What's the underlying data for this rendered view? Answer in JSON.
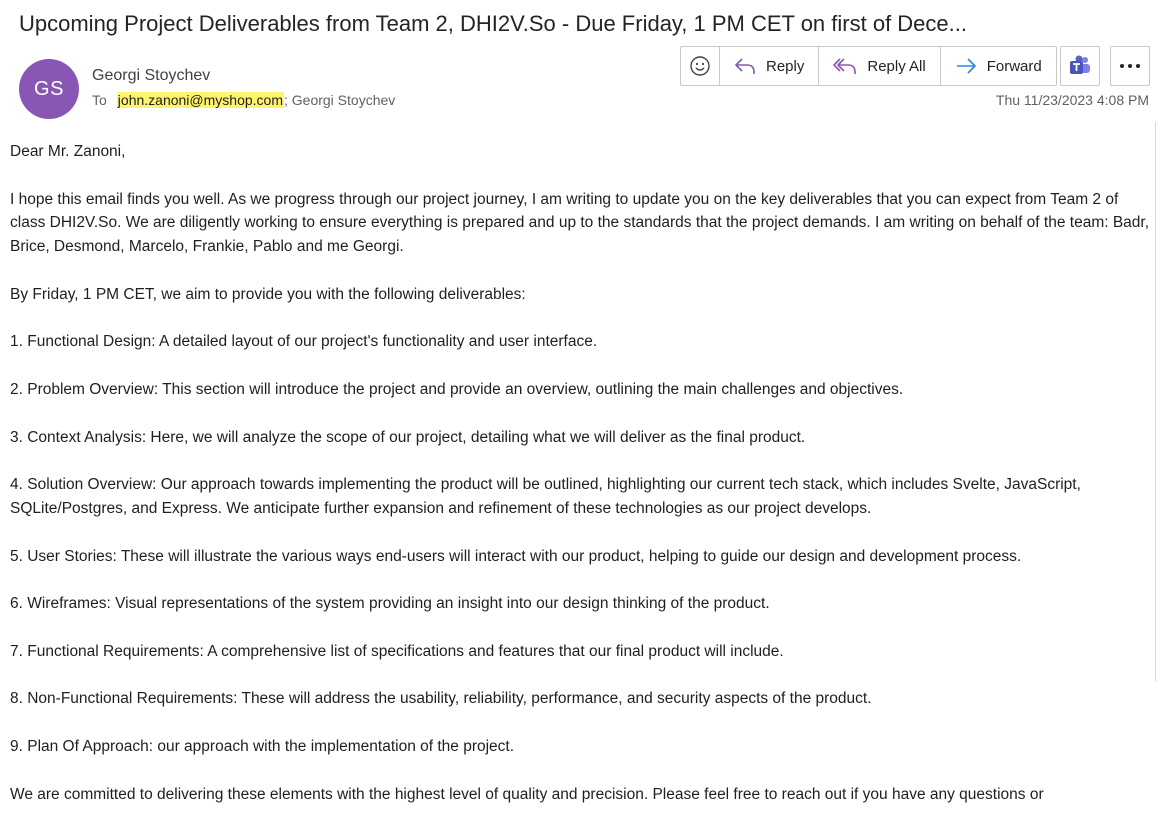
{
  "email": {
    "subject": "Upcoming Project Deliverables from Team 2, DHI2V.So - Due Friday, 1 PM CET on first of Dece...",
    "avatar_initials": "GS",
    "avatar_color": "#8a56b4",
    "sender": "Georgi Stoychev",
    "to_label": "To",
    "recipients": [
      "john.zanoni@myshop.com",
      "Georgi Stoychev"
    ],
    "recipient_separator": "; ",
    "date": "Thu 11/23/2023 4:08 PM"
  },
  "toolbar": {
    "reply_label": "Reply",
    "reply_all_label": "Reply All",
    "forward_label": "Forward"
  },
  "body": {
    "paragraphs": [
      "Dear Mr. Zanoni,",
      "I hope this email finds you well. As we progress through our project journey, I am writing to update you on the key deliverables that you can expect from Team 2 of class DHI2V.So. We are diligently working to ensure everything is prepared and up to the standards that the project demands. I am writing on behalf of the team: Badr, Brice, Desmond, Marcelo, Frankie, Pablo and me Georgi.",
      "By Friday, 1 PM CET, we aim to provide you with the following deliverables:",
      "1. Functional Design: A detailed layout of our project's functionality and user interface.",
      "2. Problem Overview: This section will introduce the project and provide an overview, outlining the main challenges and objectives.",
      "3. Context Analysis: Here, we will analyze the scope of our project, detailing what we will deliver as the final product.",
      "4. Solution Overview: Our approach towards implementing the product will be outlined, highlighting our current tech stack, which includes Svelte, JavaScript, SQLite/Postgres, and Express. We anticipate further expansion and refinement of these technologies as our project develops.",
      "5. User Stories: These will illustrate the various ways end-users will interact with our product, helping to guide our design and development process.",
      "6. Wireframes: Visual representations of the system providing an insight into our design thinking of the product.",
      "7. Functional Requirements: A comprehensive list of specifications and features that our final product will include.",
      "8. Non-Functional Requirements: These will address the usability, reliability, performance, and security aspects of the product.",
      "9. Plan Of Approach: our approach with the implementation of the project.",
      "We are committed to delivering these elements with the highest level of quality and precision. Please feel free to reach out if you have any questions or"
    ]
  },
  "colors": {
    "highlight": "#fff46b",
    "reply_icon": "#8a56b4",
    "forward_icon": "#2b88d8",
    "teams_icon": "#5b5fc7"
  }
}
